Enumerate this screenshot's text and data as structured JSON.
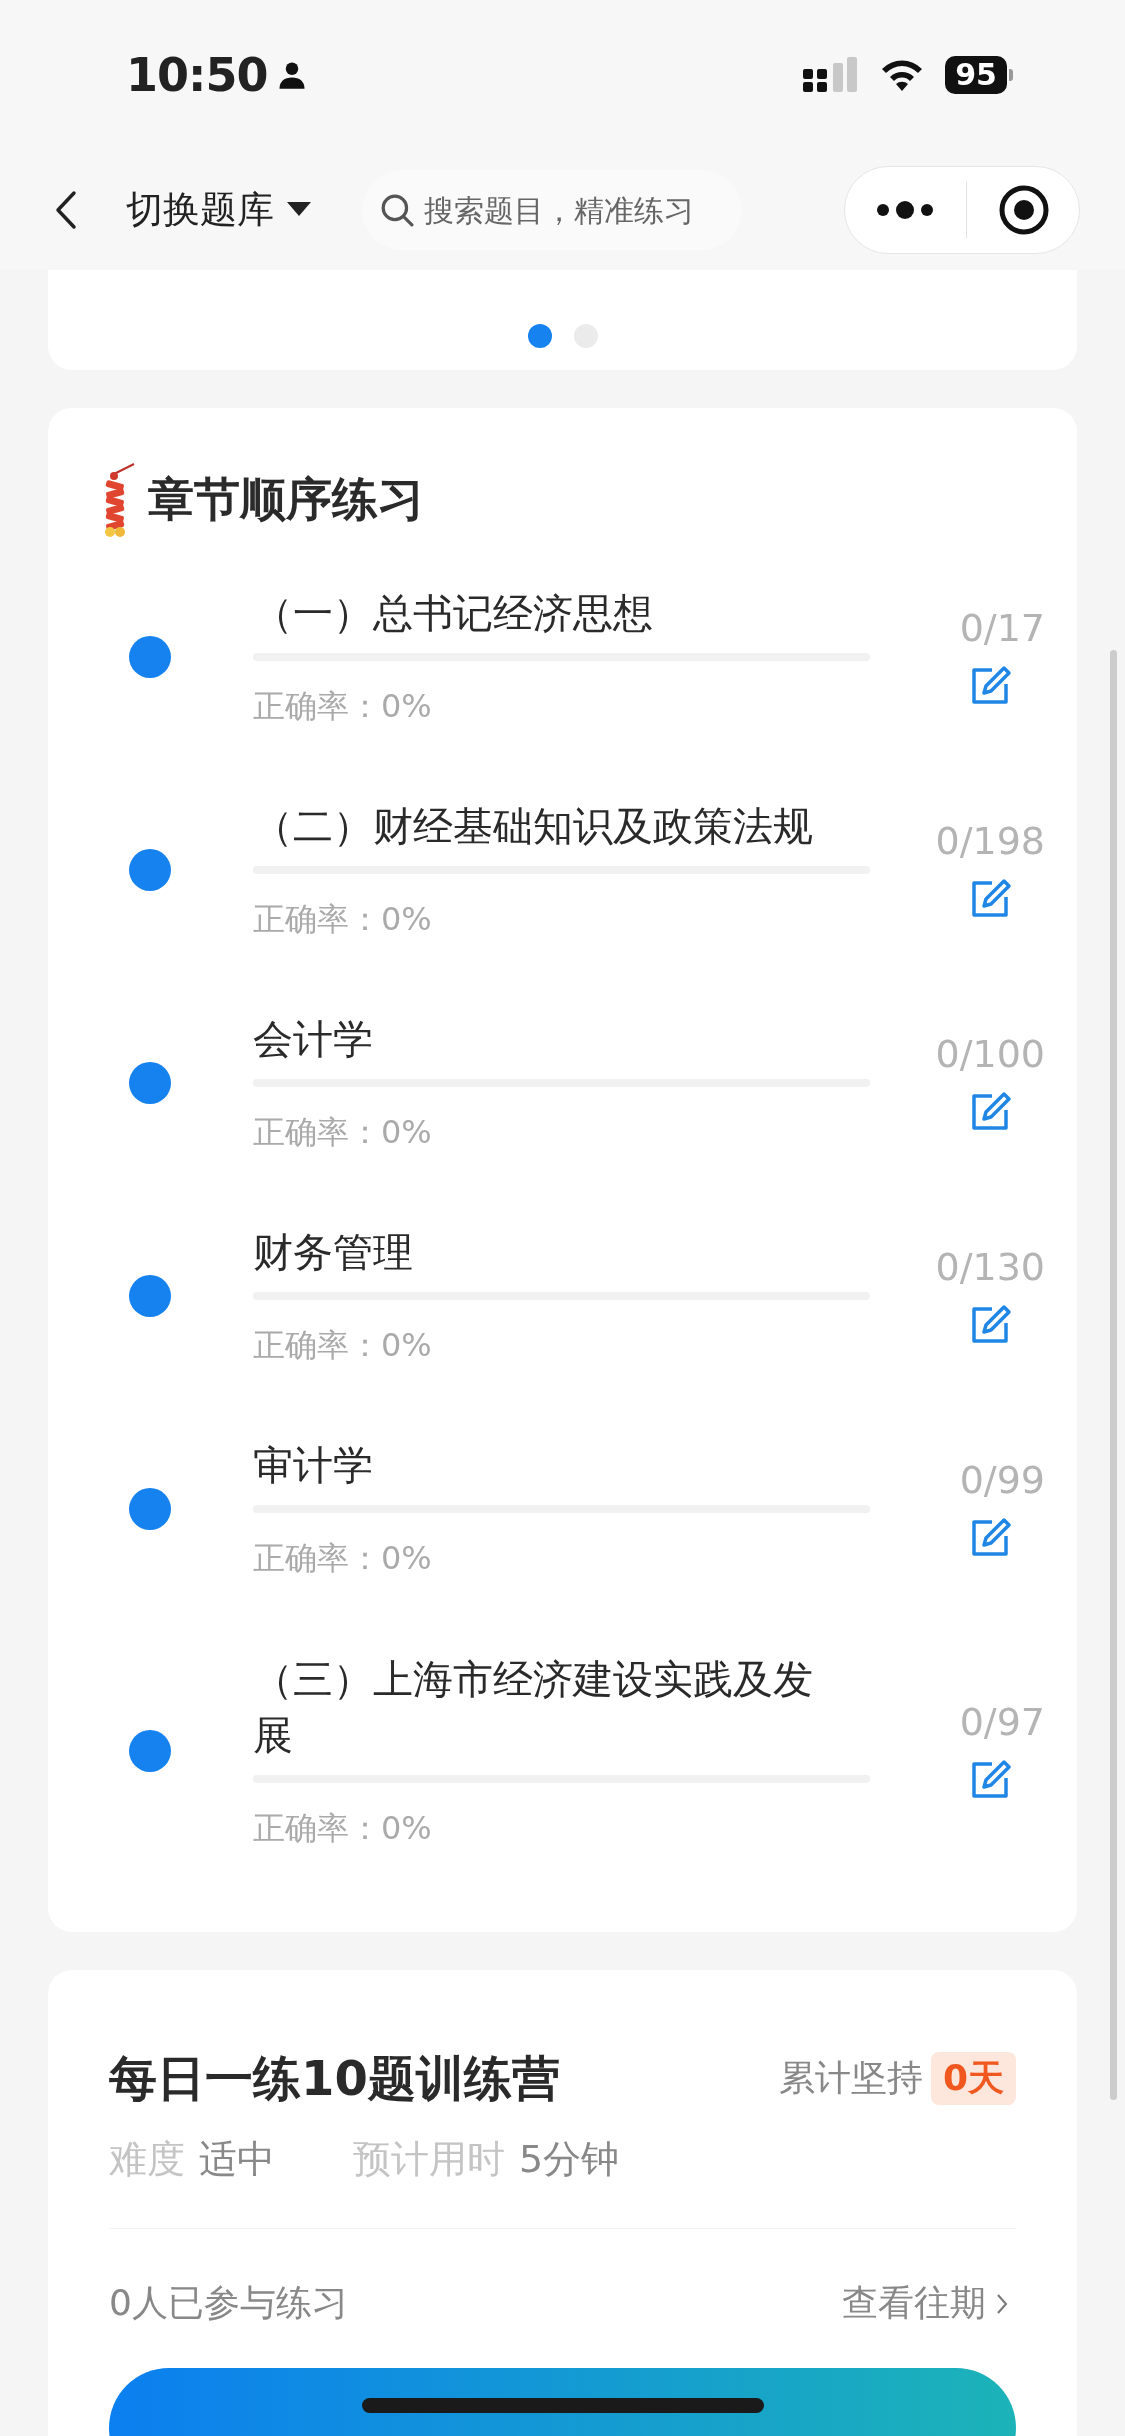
{
  "status_bar": {
    "time": "10:50",
    "battery": "95"
  },
  "nav": {
    "title": "切换题库",
    "search": {
      "placeholder": "搜索题目，精准练习"
    }
  },
  "top_card": {
    "pager": [
      {
        "selected": true
      },
      {
        "selected": false
      }
    ]
  },
  "chapters": {
    "title": "章节顺序练习",
    "items": [
      {
        "title": "（一）总书记经济思想",
        "count": "0/17",
        "accuracy": "正确率：0%",
        "level": 0
      },
      {
        "title": "（二）财经基础知识及政策法规",
        "count": "0/198",
        "accuracy": "正确率：0%",
        "level": 0
      },
      {
        "title": "会计学",
        "count": "0/100",
        "accuracy": "正确率：0%",
        "level": 0
      },
      {
        "title": "财务管理",
        "count": "0/130",
        "accuracy": "正确率：0%",
        "level": 0
      },
      {
        "title": "审计学",
        "count": "0/99",
        "accuracy": "正确率：0%",
        "level": 0
      },
      {
        "title": "（三）上海市经济建设实践及发展",
        "count": "0/97",
        "accuracy": "正确率：0%",
        "level": 0
      }
    ]
  },
  "daily": {
    "title": "每日一练10题训练营",
    "streak_label": "累计坚持",
    "streak": "0天",
    "meta": [
      {
        "label": "难度",
        "value": "适中"
      },
      {
        "label": "预计用时",
        "value": "5分钟"
      }
    ],
    "participants": "0人已参与练习",
    "history_link": "查看往期"
  }
}
